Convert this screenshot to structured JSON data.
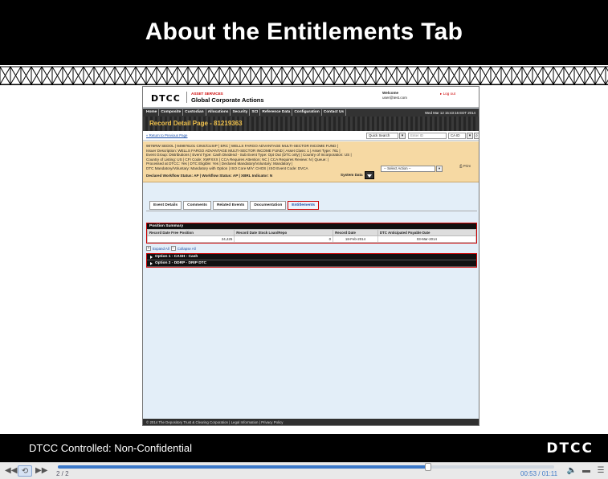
{
  "slide": {
    "title": "About the Entitlements Tab",
    "footer_text": "DTCC Controlled: Non-Confidential",
    "footer_logo": "DTCC"
  },
  "app": {
    "logo": "DTCC",
    "service_line1": "ASSET SERVICES",
    "service_line2": "Global Corporate Actions",
    "welcome_label": "Welcome",
    "welcome_user": "user@test.com",
    "logout": "Log out",
    "nav": [
      "Home",
      "Composite",
      "Custodian",
      "Allocations",
      "Security",
      "SCI",
      "Reference Data",
      "Configuration",
      "Contact Us"
    ],
    "date": "Wed Mar 12 15:43:16 EDT 2014",
    "page_title": "Record Detail Page - 81219363",
    "back_link": "« Return to Previous Page",
    "quick_search": "Quick Search",
    "enter_id_placeholder": "Enter ID",
    "ca_id": "CA ID",
    "info_lines": [
      "9876RW SEDOL | 949876101 CINS/CUSIP | ERC | WELLS FARGO ADVANTAGE MULTI-SECTOR INCOME FUND |",
      "Issuer Description: WELLS FARGO ADVANTAGE MULTI-SECTOR INCOME FUND | Asset Class: 1 | Asset Type: 761 |",
      "Event Group: Distributions | Event Type: Cash Dividend - Sub Event Type: Opt Out (DTC only) | Country of Incorporation: US |",
      "Country of Listing: US | CFI Code: XMFXXX | CCA Requires Attention: NC | CCA Requires Review: N | Queue: |",
      "Processed at DTCC: Yes | DTC Eligible: Yes | Declared Mandatory/Voluntary: Mandatory |",
      "DTC Mandatory/Voluntary: Mandatory with Option | ISO Core M/V: CHOS | ISO Event Code: DVCA"
    ],
    "workflow_line": "Declared Workflow Status: AP | Workflow Status: AP | XBRL Indicator: N",
    "select_action": "-- Select Action --",
    "print": "Print",
    "system_data": "System Data",
    "tabs": [
      {
        "label": "Event Details"
      },
      {
        "label": "Comments"
      },
      {
        "label": "Related Events"
      },
      {
        "label": "Documentation"
      },
      {
        "label": "Entitlements"
      }
    ],
    "position_summary": {
      "title": "Position Summary",
      "headers": [
        "Record Date Free Position",
        "Record Date Stock Loan/Repo",
        "Record Date",
        "DTC Anticipated Payable Date"
      ],
      "row": [
        "24,425",
        "0",
        "18-Feb-2014",
        "03-Mar-2014"
      ]
    },
    "expand_all": "Expand All",
    "collapse_all": "Collapse All",
    "options": [
      "Option 1 - CASH - Cash",
      "Option 2 - DDRP - DRIP DTC"
    ],
    "footer": "© 2014 The Depository Trust & Clearing Corporation  |  Legal Information  |  Privacy Policy"
  },
  "player": {
    "slide_count": "2 / 2",
    "time": "00:53 / 01:11",
    "progress": 0.746
  }
}
